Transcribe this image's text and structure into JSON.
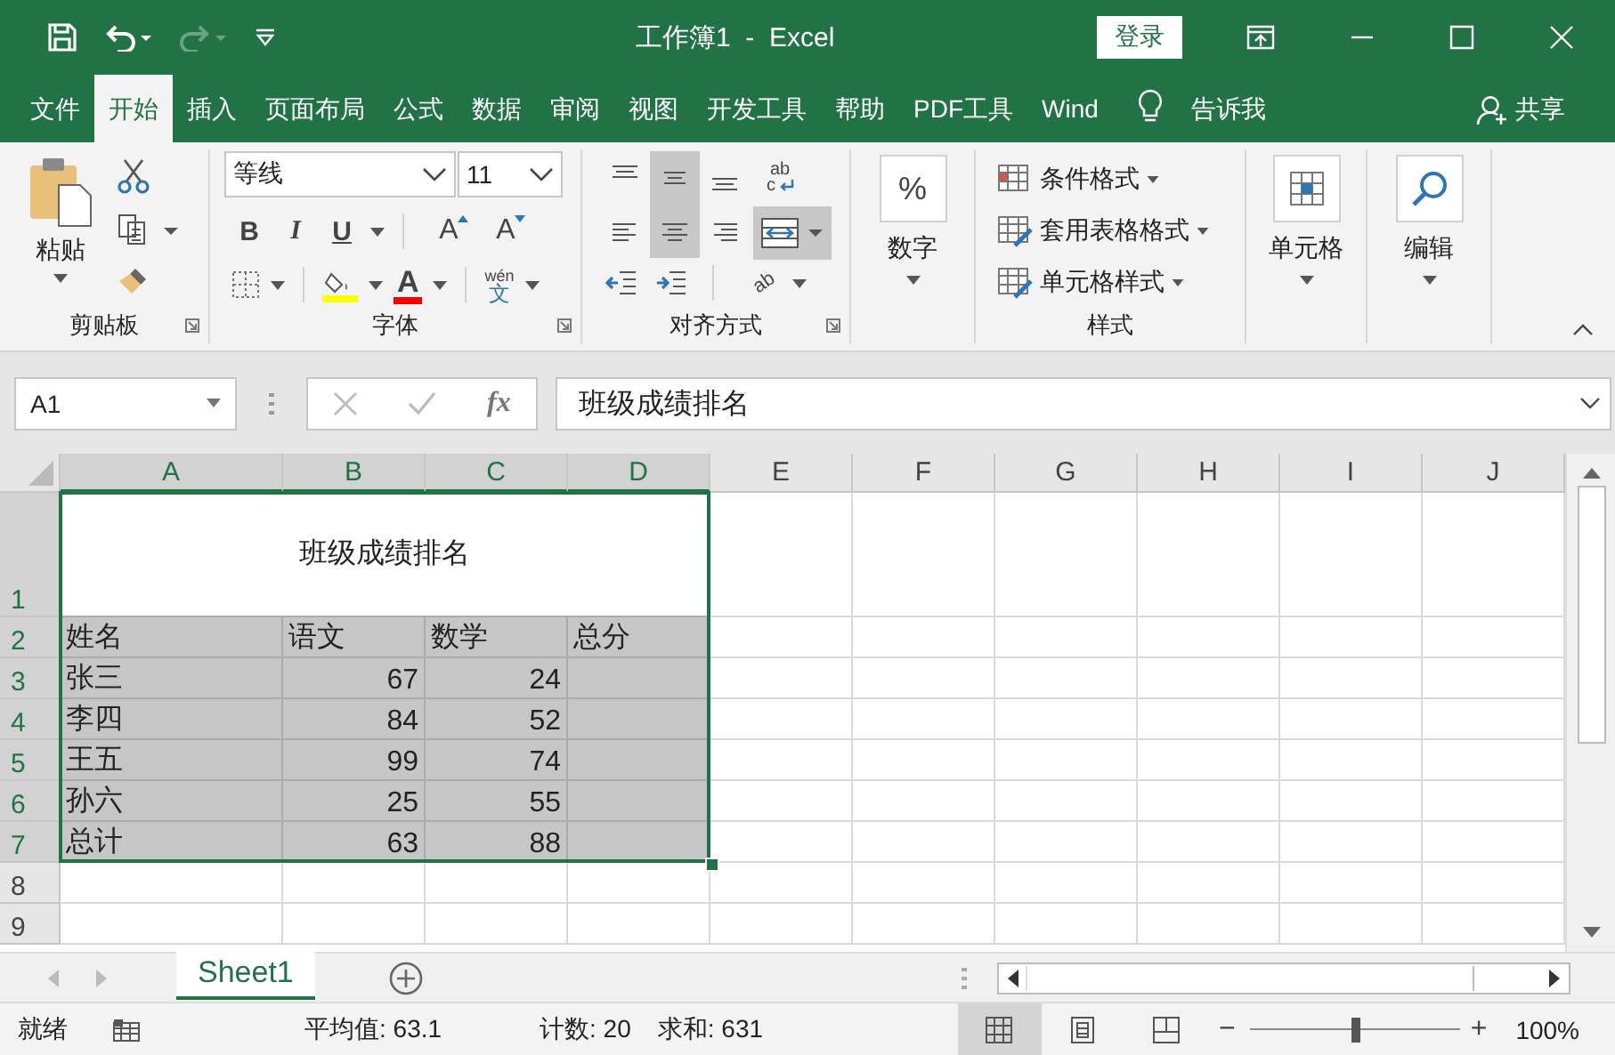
{
  "window": {
    "title": "工作簿1  -  Excel",
    "login_button": "登录"
  },
  "quick_access": [
    {
      "kind": "save",
      "disabled": false
    },
    {
      "kind": "undo",
      "disabled": false
    },
    {
      "kind": "redo",
      "disabled": true
    },
    {
      "kind": "customize",
      "disabled": false
    }
  ],
  "tabs": [
    {
      "label": "文件",
      "selected": false
    },
    {
      "label": "开始",
      "selected": true
    },
    {
      "label": "插入",
      "selected": false
    },
    {
      "label": "页面布局",
      "selected": false
    },
    {
      "label": "公式",
      "selected": false
    },
    {
      "label": "数据",
      "selected": false
    },
    {
      "label": "审阅",
      "selected": false
    },
    {
      "label": "视图",
      "selected": false
    },
    {
      "label": "开发工具",
      "selected": false
    },
    {
      "label": "帮助",
      "selected": false
    },
    {
      "label": "PDF工具",
      "selected": false
    },
    {
      "label": "Wind",
      "selected": false
    }
  ],
  "tell_me": "告诉我",
  "share": "共享",
  "ribbon": {
    "clipboard": {
      "label": "剪贴板",
      "paste": "粘贴"
    },
    "font": {
      "label": "字体",
      "font_name": "等线",
      "font_size": "11",
      "bold": "B",
      "italic": "I",
      "underline": "U",
      "grow": "A",
      "shrink": "A",
      "font_color": "A",
      "phonetic": "wén",
      "phonetic_char": "文"
    },
    "alignment": {
      "label": "对齐方式",
      "wrap_top": "ab",
      "wrap_bottom": "c",
      "orientation": "ab",
      "merge_selected": true,
      "buttons": [
        {
          "kind": "top",
          "selected": false
        },
        {
          "kind": "middle",
          "selected": true
        },
        {
          "kind": "bottom",
          "selected": false
        },
        {
          "kind": "left",
          "selected": false
        },
        {
          "kind": "center",
          "selected": true
        },
        {
          "kind": "right",
          "selected": false
        }
      ]
    },
    "number": {
      "label": "数字",
      "symbol": "%"
    },
    "styles": {
      "label": "样式",
      "items": [
        "条件格式",
        "套用表格格式",
        "单元格样式"
      ]
    },
    "cells": {
      "label": "单元格"
    },
    "editing": {
      "label": "编辑"
    }
  },
  "formula_bar": {
    "name_box": "A1",
    "fx": "fx",
    "value": "班级成绩排名"
  },
  "sheet": {
    "columns": [
      {
        "label": "A",
        "selected": true
      },
      {
        "label": "B",
        "selected": true
      },
      {
        "label": "C",
        "selected": true
      },
      {
        "label": "D",
        "selected": true
      },
      {
        "label": "E",
        "selected": false
      },
      {
        "label": "F",
        "selected": false
      },
      {
        "label": "G",
        "selected": false
      },
      {
        "label": "H",
        "selected": false
      },
      {
        "label": "I",
        "selected": false
      },
      {
        "label": "J",
        "selected": false
      }
    ],
    "rows": [
      {
        "number": "1",
        "selected": true,
        "kind": "title",
        "cells": [
          "班级成绩排名"
        ]
      },
      {
        "number": "2",
        "selected": true,
        "kind": "header",
        "cells": [
          "姓名",
          "语文",
          "数学",
          "总分"
        ]
      },
      {
        "number": "3",
        "selected": true,
        "kind": "data",
        "cells": [
          "张三",
          "67",
          "24"
        ]
      },
      {
        "number": "4",
        "selected": true,
        "kind": "data",
        "cells": [
          "李四",
          "84",
          "52"
        ]
      },
      {
        "number": "5",
        "selected": true,
        "kind": "data",
        "cells": [
          "王五",
          "99",
          "74"
        ]
      },
      {
        "number": "6",
        "selected": true,
        "kind": "data",
        "cells": [
          "孙六",
          "25",
          "55"
        ]
      },
      {
        "number": "7",
        "selected": true,
        "kind": "data",
        "cells": [
          "总计",
          "63",
          "88"
        ]
      },
      {
        "number": "8",
        "selected": false,
        "kind": "empty"
      },
      {
        "number": "9",
        "selected": false,
        "kind": "empty"
      }
    ]
  },
  "sheet_tabs": [
    {
      "label": "Sheet1",
      "selected": true
    }
  ],
  "status_bar": {
    "mode": "就绪",
    "average": "平均值: 63.1",
    "count": "计数: 20",
    "sum": "求和: 631",
    "views": [
      {
        "kind": "normal",
        "selected": true
      },
      {
        "kind": "page_layout",
        "selected": false
      },
      {
        "kind": "page_break",
        "selected": false
      }
    ],
    "zoom_out": "−",
    "zoom_in": "+",
    "zoom_slider": {
      "level": 0.5
    },
    "zoom": "100%"
  }
}
